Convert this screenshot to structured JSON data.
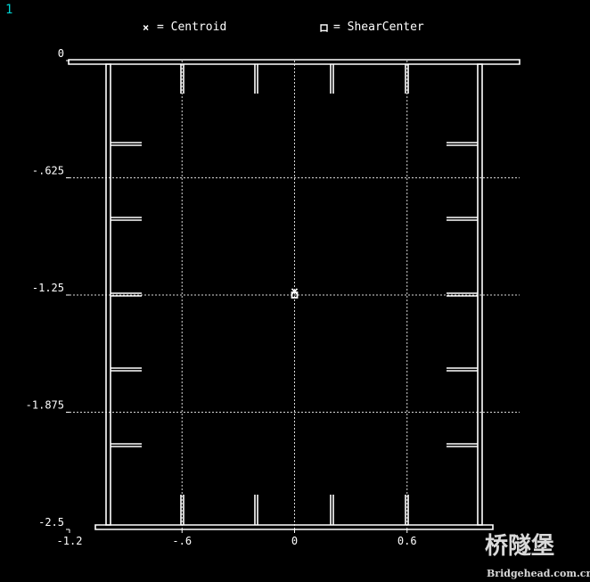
{
  "window_number": "1",
  "legend": {
    "centroid_symbol": "×",
    "centroid_label": "= Centroid",
    "shear_symbol": "ロ",
    "shear_label": "= ShearCenter"
  },
  "chart_data": {
    "type": "diagram",
    "xlim": [
      -1.2,
      1.2
    ],
    "ylim": [
      -2.5,
      0
    ],
    "x_ticks": [
      {
        "value": -1.2,
        "label": "-1.2"
      },
      {
        "value": -0.6,
        "label": "-.6"
      },
      {
        "value": 0,
        "label": "0"
      },
      {
        "value": 0.6,
        "label": "0.6"
      }
    ],
    "y_ticks": [
      {
        "value": 0,
        "label": "0"
      },
      {
        "value": -0.625,
        "label": "-.625"
      },
      {
        "value": -1.25,
        "label": "-1.25"
      },
      {
        "value": -1.875,
        "label": "-1.875"
      },
      {
        "value": -2.5,
        "label": "-2.5"
      }
    ],
    "grid": true,
    "centroid": [
      0,
      -1.25
    ],
    "shear_center": [
      0,
      -1.25
    ]
  },
  "watermark": {
    "chinese": "桥隧堡",
    "site": "Bridgehead.com.cn"
  },
  "colors": {
    "background": "#000000",
    "line": "#ffffff",
    "grid": "#d8d8d8",
    "text": "#ffffff",
    "window_number": "#00d0d0"
  }
}
